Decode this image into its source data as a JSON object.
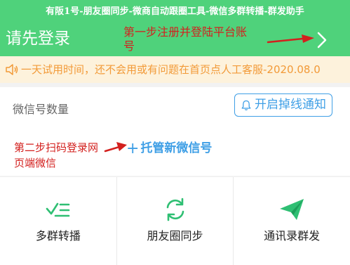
{
  "top_banner": {
    "text": "有阪1号-朋友圈同步-微商自动跟圈工具-微信多群转播-群发助手"
  },
  "header": {
    "login_title": "请先登录",
    "annotation": "第一步注册并登陆平台账号",
    "chevron_icon": "chevron-right-icon"
  },
  "notice": {
    "icon": "speaker-icon",
    "text": "一天试用时间，还不会用或有问题在首页点人工客服-2020.08.0"
  },
  "account": {
    "count_label": "微信号数量",
    "notify_button": "开启掉线通知",
    "notify_icon": "bell-icon",
    "add_link": "托管新微信号",
    "add_icon": "+",
    "annotation": "第二步扫码登录网页端微信"
  },
  "features": [
    {
      "label": "多群转播",
      "icon": "broadcast-list-icon"
    },
    {
      "label": "朋友圈同步",
      "icon": "sync-icon"
    },
    {
      "label": "通讯录群发",
      "icon": "send-icon"
    }
  ],
  "colors": {
    "brand_green": "#4fd27b",
    "notice_bg": "#fdf2dc",
    "notice_text": "#f29a38",
    "link_blue": "#3f9fe6",
    "annotation_red": "#d3201e"
  }
}
